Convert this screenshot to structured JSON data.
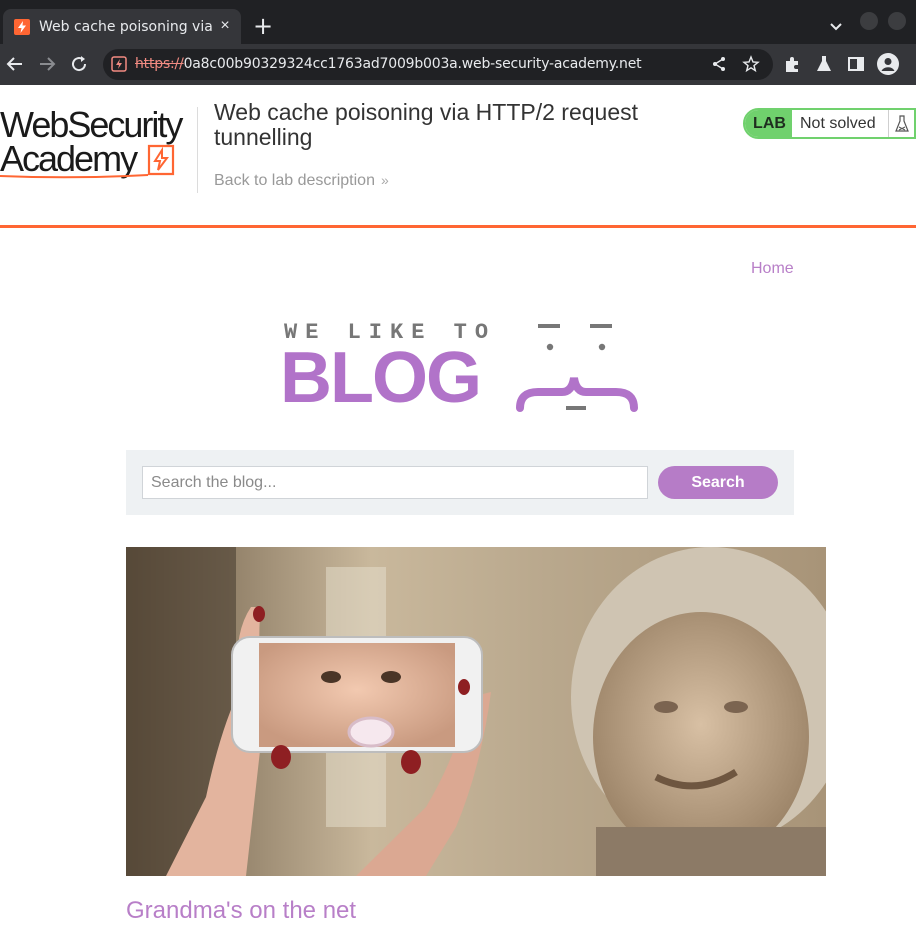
{
  "browser": {
    "tab_title": "Web cache poisoning via HTTP/2 request tunnelling",
    "url_scheme": "https://",
    "url_host": "0a8c00b90329324cc1763ad7009b003a.web-security-academy.net"
  },
  "lab": {
    "logo_line1": "WebSecurity",
    "logo_line2": "Academy",
    "title": "Web cache poisoning via HTTP/2 request tunnelling",
    "back_link": "Back to lab description",
    "badge": "LAB",
    "status": "Not solved"
  },
  "blog": {
    "nav_home": "Home",
    "logo_tagline": "WE LIKE TO",
    "logo_word": "BLOG",
    "search_placeholder": "Search the blog...",
    "search_button": "Search",
    "post_title": "Grandma's on the net"
  },
  "colors": {
    "accent_orange": "#ff6633",
    "blog_purple": "#b173c9",
    "lab_green": "#70d16d"
  }
}
